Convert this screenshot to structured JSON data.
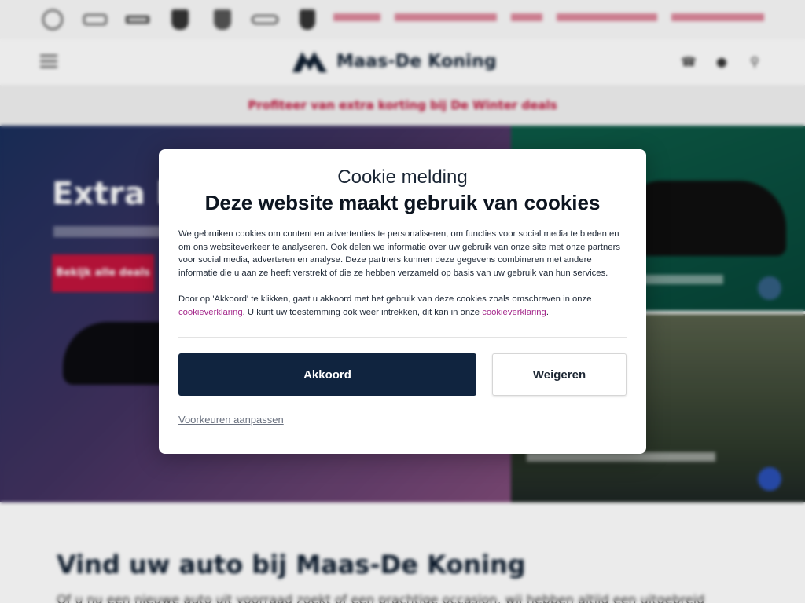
{
  "header": {
    "brand_name": "Maas-De Koning",
    "brand_logos": [
      "volkswagen-logo",
      "seat-logo",
      "cupra-logo",
      "skoda-logo",
      "peugeot-logo",
      "audi-logo",
      "porsche-logo"
    ],
    "icons": [
      "phone-icon",
      "location-icon",
      "search-icon"
    ]
  },
  "promo": {
    "text": "Profiteer van extra korting bij De Winter deals"
  },
  "hero": {
    "title": "Extra k",
    "button_label": "Bekijk alle deals"
  },
  "section": {
    "title": "Vind uw auto bij Maas-De Koning",
    "text": "Of u nu een nieuwe auto uit voorraad zoekt of een prachtige occasion, wij hebben altijd een uitgebreid"
  },
  "cookie": {
    "kicker": "Cookie melding",
    "title": "Deze website maakt gebruik van cookies",
    "paragraph1": "We gebruiken cookies om content en advertenties te personaliseren, om functies voor social media te bieden en om ons websiteverkeer te analyseren. Ook delen we informatie over uw gebruik van onze site met onze partners voor social media, adverteren en analyse. Deze partners kunnen deze gegevens combineren met andere informatie die u aan ze heeft verstrekt of die ze hebben verzameld op basis van uw gebruik van hun services.",
    "paragraph2_a": "Door op 'Akkoord' te klikken, gaat u akkoord met het gebruik van deze cookies zoals omschreven in onze ",
    "link1": "cookieverklaring",
    "paragraph2_b": ". U kunt uw toestemming ook weer intrekken, dit kan in onze ",
    "link2": "cookieverklaring",
    "paragraph2_c": ".",
    "accept_label": "Akkoord",
    "decline_label": "Weigeren",
    "preferences_label": "Voorkeuren aanpassen"
  },
  "colors": {
    "accent_red": "#c0143c",
    "navy": "#10243f",
    "link_purple": "#a52a8c"
  }
}
